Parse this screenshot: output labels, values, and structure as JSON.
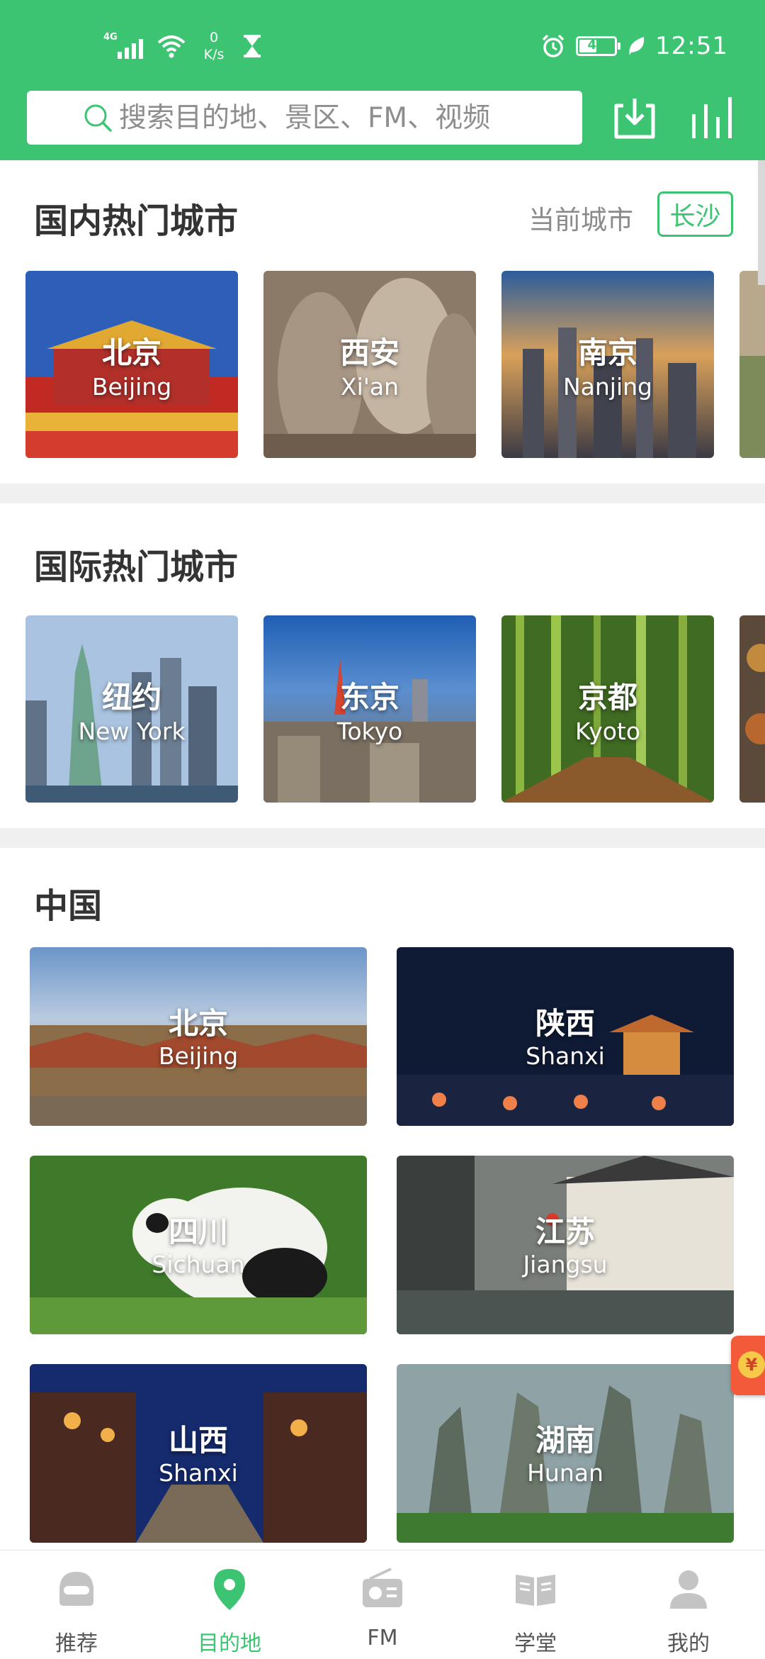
{
  "status_bar": {
    "network_tag": "4G",
    "speed_value": "0",
    "speed_unit": "K/s",
    "battery_level": "49",
    "time": "12:51"
  },
  "search": {
    "placeholder": "搜索目的地、景区、FM、视频"
  },
  "domestic": {
    "title": "国内热门城市",
    "current_city_label": "当前城市",
    "current_city": "长沙",
    "cities": [
      {
        "name": "北京",
        "en": "Beijing"
      },
      {
        "name": "西安",
        "en": "Xi'an"
      },
      {
        "name": "南京",
        "en": "Nanjing"
      }
    ]
  },
  "international": {
    "title": "国际热门城市",
    "cities": [
      {
        "name": "纽约",
        "en": "New York"
      },
      {
        "name": "东京",
        "en": "Tokyo"
      },
      {
        "name": "京都",
        "en": "Kyoto"
      }
    ]
  },
  "china": {
    "title": "中国",
    "regions": [
      {
        "name": "北京",
        "en": "Beijing"
      },
      {
        "name": "陕西",
        "en": "Shanxi"
      },
      {
        "name": "四川",
        "en": "Sichuan"
      },
      {
        "name": "江苏",
        "en": "Jiangsu"
      },
      {
        "name": "山西",
        "en": "Shanxi"
      },
      {
        "name": "湖南",
        "en": "Hunan"
      }
    ]
  },
  "red_packet_symbol": "¥",
  "bottom_nav": [
    {
      "label": "推荐",
      "icon": "recommend-icon"
    },
    {
      "label": "目的地",
      "icon": "location-pin-icon",
      "active": true
    },
    {
      "label": "FM",
      "icon": "radio-icon"
    },
    {
      "label": "学堂",
      "icon": "book-icon"
    },
    {
      "label": "我的",
      "icon": "person-icon"
    }
  ],
  "colors": {
    "brand": "#3cc472",
    "nav_inactive": "#c4c4c4",
    "red_packet": "#f25a3a"
  }
}
